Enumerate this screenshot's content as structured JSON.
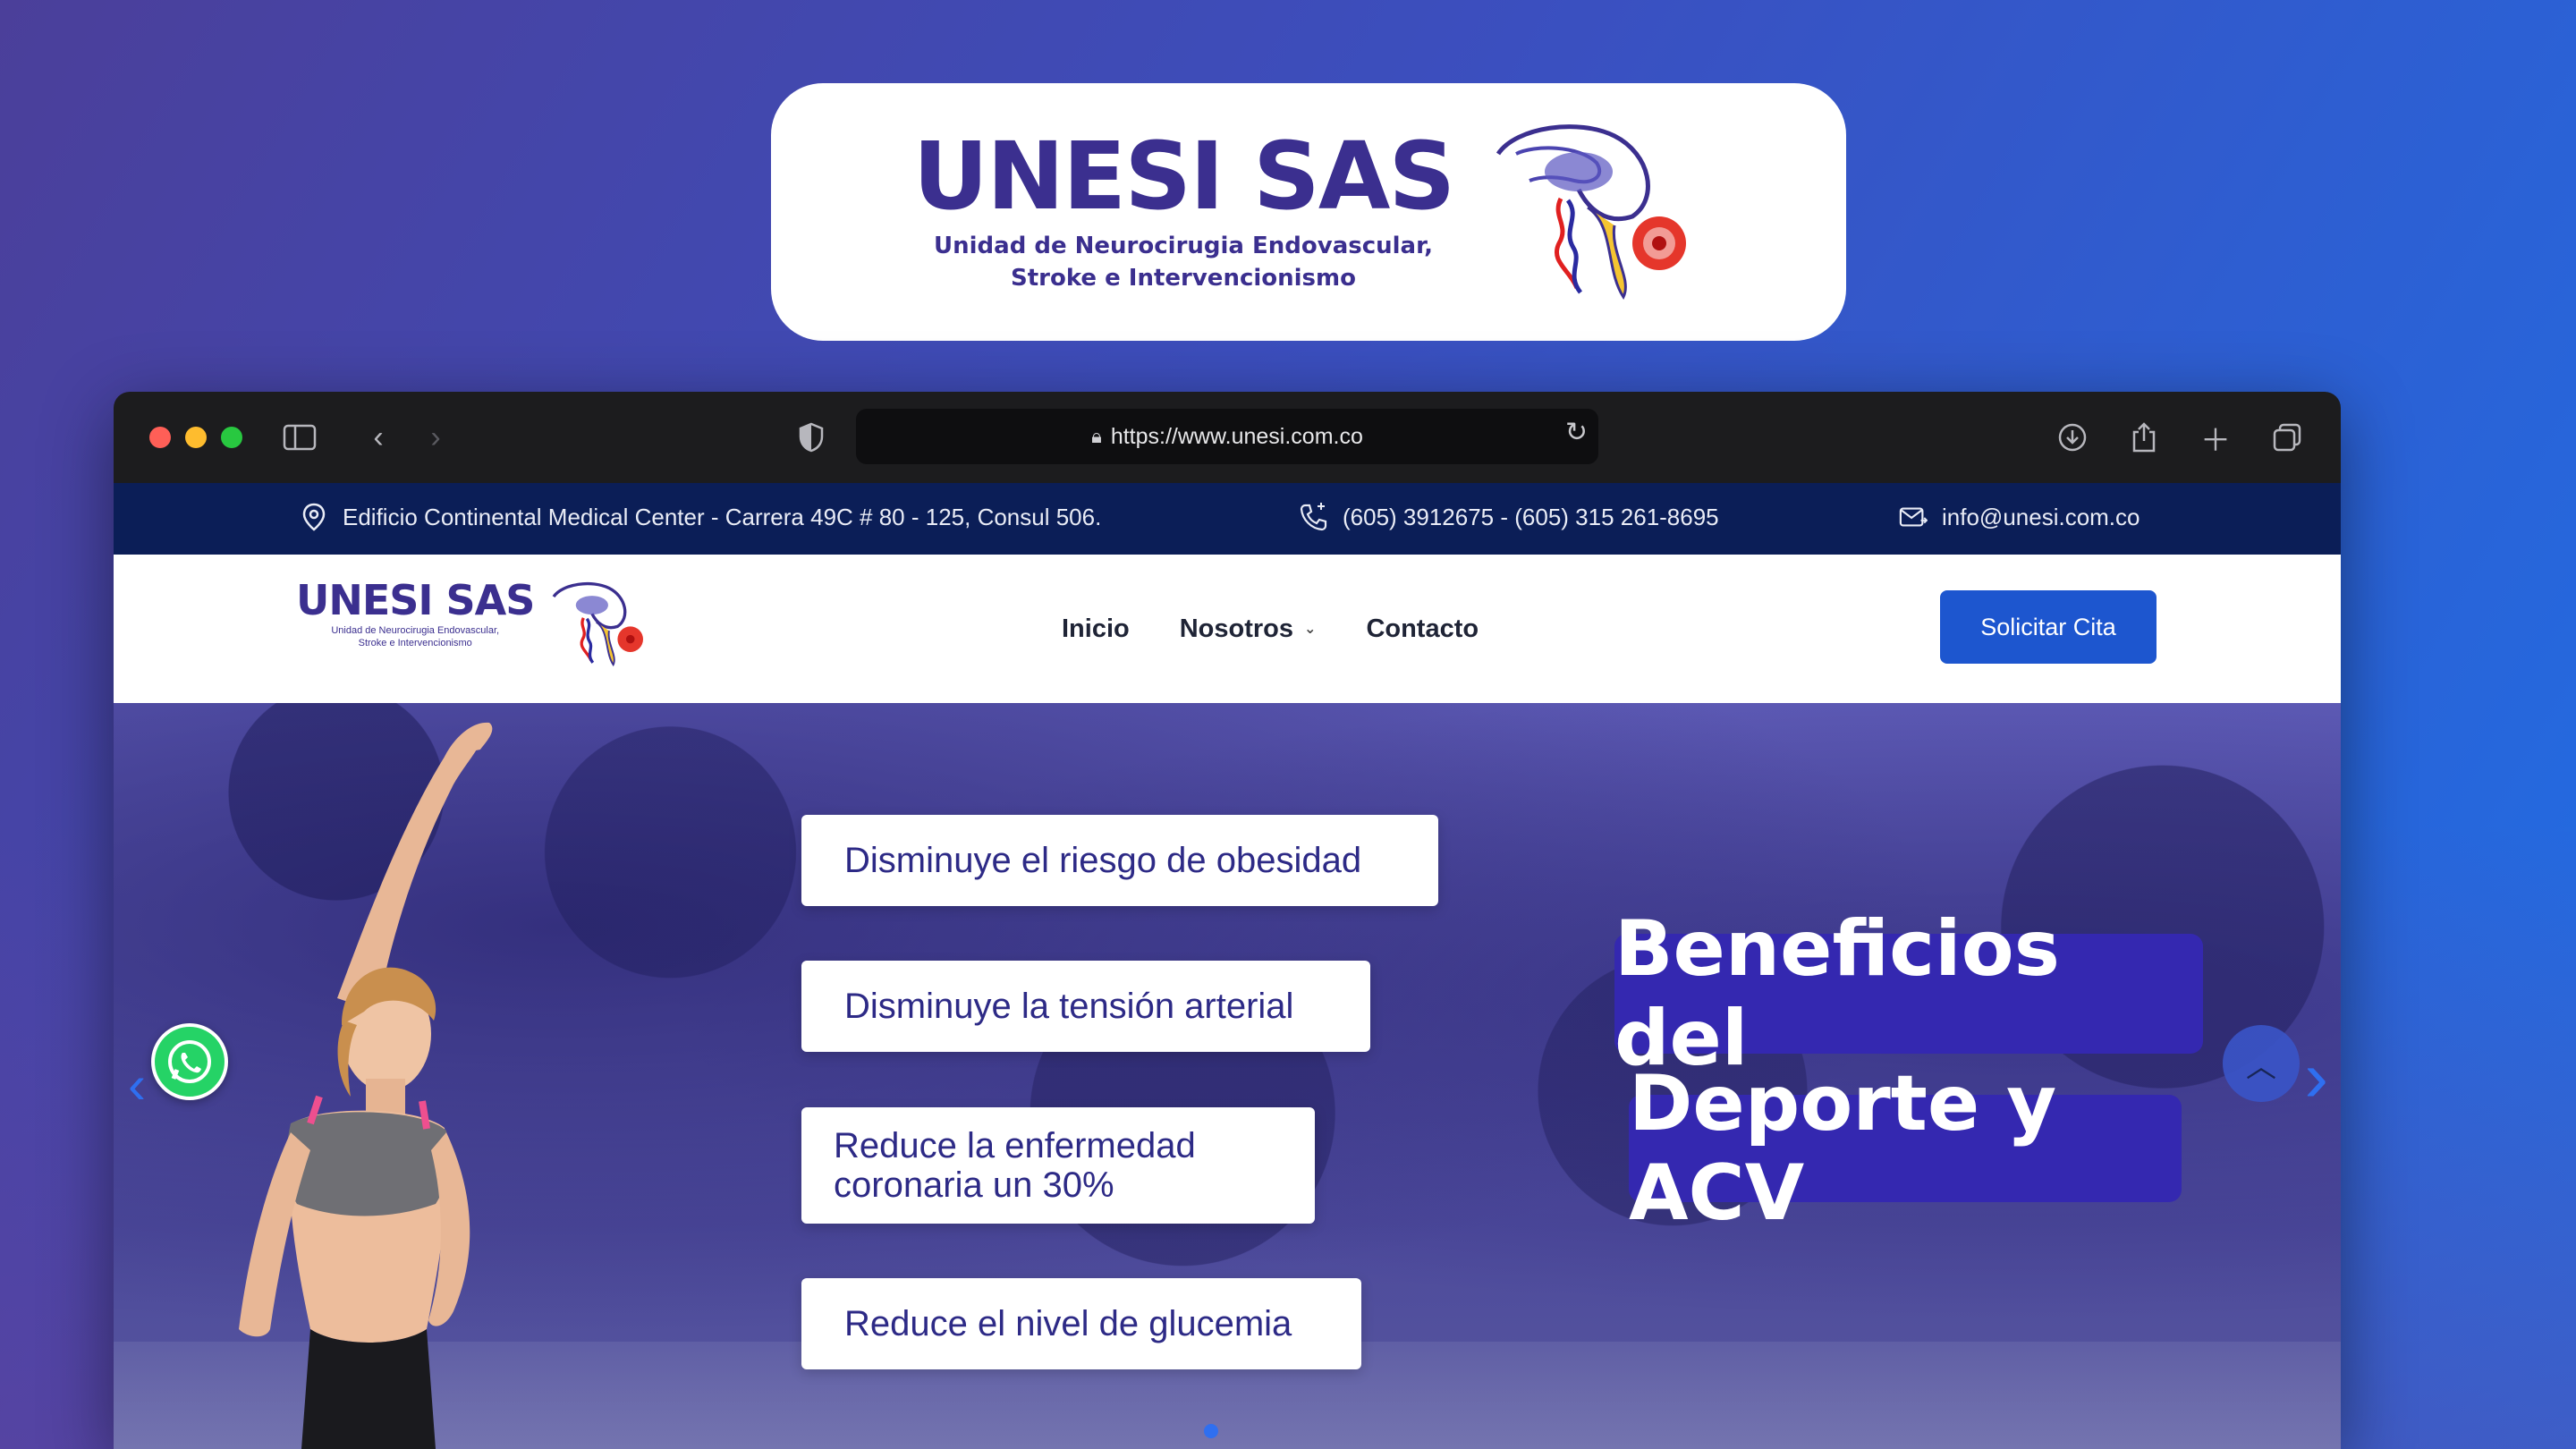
{
  "brand_card": {
    "title": "UNESI SAS",
    "subtitle_line1": "Unidad de Neurocirugia Endovascular,",
    "subtitle_line2": "Stroke e Intervencionismo"
  },
  "browser": {
    "url": "https://www.unesi.com.co"
  },
  "infobar": {
    "address": "Edificio Continental Medical Center - Carrera 49C # 80 - 125, Consul 506.",
    "phone": "(605) 3912675 - (605) 315 261-8695",
    "email": "info@unesi.com.co",
    "background_color": "#0b1e57"
  },
  "site_header": {
    "logo_title": "UNESI SAS",
    "logo_sub_line1": "Unidad de Neurocirugia Endovascular,",
    "logo_sub_line2": "Stroke e Intervencionismo",
    "nav": [
      {
        "label": "Inicio"
      },
      {
        "label": "Nosotros"
      },
      {
        "label": "Contacto"
      }
    ],
    "cta_label": "Solicitar Cita",
    "cta_color": "#1d56cf"
  },
  "hero": {
    "benefits": [
      "Disminuye el riesgo de obesidad",
      "Disminuye la tensión arterial",
      "Reduce la enfermedad coronaria un 30%",
      "Reduce el nivel de glucemia"
    ],
    "headline_line1": "Beneficios del",
    "headline_line2": "Deporte y ACV",
    "headline_color": "#3428b0"
  }
}
